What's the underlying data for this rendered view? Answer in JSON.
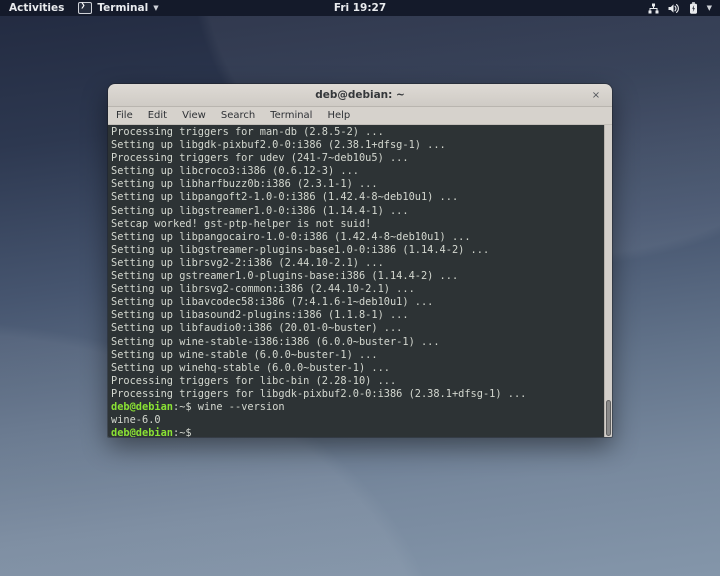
{
  "colors": {
    "topbar_bg": "#141a2a",
    "terminal_bg": "#2d3335",
    "terminal_fg": "#d3d7cf",
    "prompt_green": "#8ae234",
    "titlebar_bg": "#d7d3ce",
    "desktop_top": "#222a40",
    "desktop_bottom": "#8496aa"
  },
  "topbar": {
    "activities": "Activities",
    "app_name": "Terminal",
    "app_caret": "▼",
    "clock": "Fri 19:27",
    "status_icons": [
      "network-wired-icon",
      "volume-icon",
      "battery-icon",
      "chevron-down-icon"
    ]
  },
  "term_window": {
    "title": "deb@debian: ~",
    "close_label": "×",
    "menu": [
      "File",
      "Edit",
      "View",
      "Search",
      "Terminal",
      "Help"
    ]
  },
  "terminal": {
    "lines": [
      {
        "t": "out",
        "text": "Processing triggers for man-db (2.8.5-2) ..."
      },
      {
        "t": "out",
        "text": "Setting up libgdk-pixbuf2.0-0:i386 (2.38.1+dfsg-1) ..."
      },
      {
        "t": "out",
        "text": "Processing triggers for udev (241-7~deb10u5) ..."
      },
      {
        "t": "out",
        "text": "Setting up libcroco3:i386 (0.6.12-3) ..."
      },
      {
        "t": "out",
        "text": "Setting up libharfbuzz0b:i386 (2.3.1-1) ..."
      },
      {
        "t": "out",
        "text": "Setting up libpangoft2-1.0-0:i386 (1.42.4-8~deb10u1) ..."
      },
      {
        "t": "out",
        "text": "Setting up libgstreamer1.0-0:i386 (1.14.4-1) ..."
      },
      {
        "t": "out",
        "text": "Setcap worked! gst-ptp-helper is not suid!"
      },
      {
        "t": "out",
        "text": "Setting up libpangocairo-1.0-0:i386 (1.42.4-8~deb10u1) ..."
      },
      {
        "t": "out",
        "text": "Setting up libgstreamer-plugins-base1.0-0:i386 (1.14.4-2) ..."
      },
      {
        "t": "out",
        "text": "Setting up librsvg2-2:i386 (2.44.10-2.1) ..."
      },
      {
        "t": "out",
        "text": "Setting up gstreamer1.0-plugins-base:i386 (1.14.4-2) ..."
      },
      {
        "t": "out",
        "text": "Setting up librsvg2-common:i386 (2.44.10-2.1) ..."
      },
      {
        "t": "out",
        "text": "Setting up libavcodec58:i386 (7:4.1.6-1~deb10u1) ..."
      },
      {
        "t": "out",
        "text": "Setting up libasound2-plugins:i386 (1.1.8-1) ..."
      },
      {
        "t": "out",
        "text": "Setting up libfaudio0:i386 (20.01-0~buster) ..."
      },
      {
        "t": "out",
        "text": "Setting up wine-stable-i386:i386 (6.0.0~buster-1) ..."
      },
      {
        "t": "out",
        "text": "Setting up wine-stable (6.0.0~buster-1) ..."
      },
      {
        "t": "out",
        "text": "Setting up winehq-stable (6.0.0~buster-1) ..."
      },
      {
        "t": "out",
        "text": "Processing triggers for libc-bin (2.28-10) ..."
      },
      {
        "t": "out",
        "text": "Processing triggers for libgdk-pixbuf2.0-0:i386 (2.38.1+dfsg-1) ..."
      },
      {
        "t": "cmd",
        "user": "deb@debian",
        "path": ":~$",
        "cmd": " wine --version"
      },
      {
        "t": "out",
        "text": "wine-6.0"
      },
      {
        "t": "cmd",
        "user": "deb@debian",
        "path": ":~$",
        "cmd": ""
      }
    ]
  }
}
